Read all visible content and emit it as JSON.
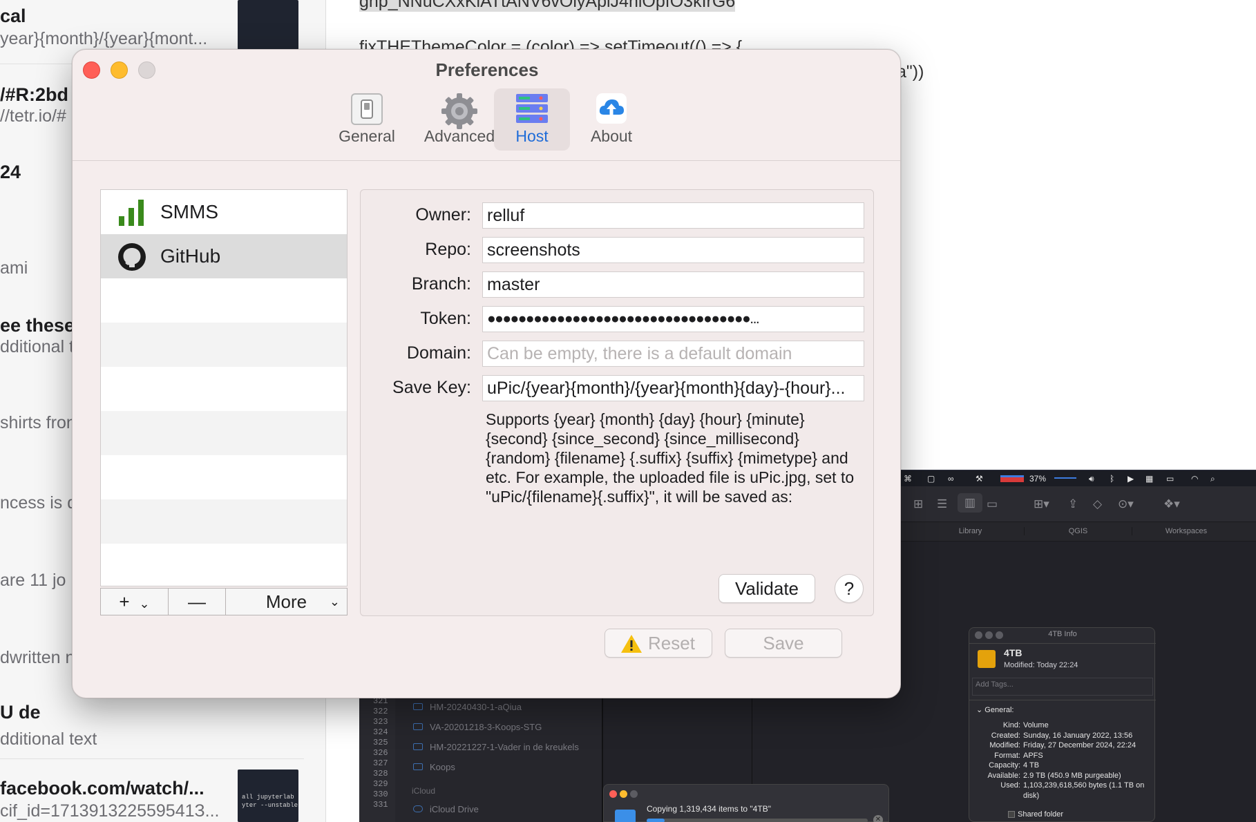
{
  "background_notes": [
    {
      "title": "cal",
      "subtitle": "year}{month}/{year}{mont..."
    },
    {
      "title": "/#R:2bd",
      "subtitle": "//tetr.io/#"
    },
    {
      "title": "24",
      "subtitle": ""
    },
    {
      "title": "",
      "subtitle": "ami"
    },
    {
      "title": "ee these",
      "subtitle": "dditional t"
    },
    {
      "title": "",
      "subtitle": "shirts fron"
    },
    {
      "title": "",
      "subtitle": "ncess is d"
    },
    {
      "title": "",
      "subtitle": "are 11 jo"
    },
    {
      "title": "",
      "subtitle": "dwritten n"
    },
    {
      "title": "U de",
      "subtitle": "dditional text"
    },
    {
      "title": "facebook.com/watch/...",
      "subtitle": "cif_id=171391322559541З..."
    }
  ],
  "thumb_code": "all jupyterlab\nyter --unstable",
  "editor": {
    "line1": "ghp_NNuCXxKlATtANV6vOlyApiJ4nlOpfO3kIrG6",
    "line2": "fixTHEThemeColor = (color) => setTimeout(() => {",
    "line3": "a\"))"
  },
  "menubar": {
    "battery_pct": "37%"
  },
  "finder": {
    "tabs": [
      "Library",
      "QGIS",
      "Workspaces"
    ],
    "line_numbers": [
      "321",
      "322",
      "323",
      "324",
      "325",
      "326",
      "327",
      "328",
      "329",
      "330",
      "331"
    ],
    "sidebar_items": [
      "HM-20240430-1-aQiua",
      "VA-20201218-3-Koops-STG",
      "HM-20221227-1-Vader in de kreukels",
      "Koops"
    ],
    "sidebar_header": "iCloud",
    "icloud_drive": "iCloud Drive"
  },
  "info_window": {
    "title": "4TB Info",
    "name": "4TB",
    "modified": "Modified: Today 22:24",
    "add_tags": "Add Tags...",
    "general": "General:",
    "rows": [
      {
        "k": "Kind:",
        "v": "Volume"
      },
      {
        "k": "Created:",
        "v": "Sunday, 16 January 2022, 13:56"
      },
      {
        "k": "Modified:",
        "v": "Friday, 27 December 2024, 22:24"
      },
      {
        "k": "Format:",
        "v": "APFS"
      },
      {
        "k": "Capacity:",
        "v": "4 TB"
      },
      {
        "k": "Available:",
        "v": "2.9 TB (450.9 MB purgeable)"
      },
      {
        "k": "Used:",
        "v": "1,103,239,618,560 bytes (1.1 TB on disk)"
      }
    ],
    "shared_folder": "Shared folder"
  },
  "copy_window": {
    "text": "Copying 1,319,434 items to \"4TB\""
  },
  "prefs": {
    "title": "Preferences",
    "tabs": [
      {
        "label": "General",
        "icon": "switch-icon"
      },
      {
        "label": "Advanced",
        "icon": "gear-icon"
      },
      {
        "label": "Host",
        "icon": "server-icon",
        "selected": true
      },
      {
        "label": "About",
        "icon": "cloud-upload-icon"
      }
    ],
    "hosts": [
      {
        "name": "SMMS",
        "icon": "bar-chart-icon"
      },
      {
        "name": "GitHub",
        "icon": "github-icon",
        "selected": true
      }
    ],
    "list_buttons": {
      "add": "+",
      "remove": "—",
      "more": "More"
    },
    "fields": {
      "owner": {
        "label": "Owner:",
        "value": "relluf"
      },
      "repo": {
        "label": "Repo:",
        "value": "screenshots"
      },
      "branch": {
        "label": "Branch:",
        "value": "master"
      },
      "token": {
        "label": "Token:",
        "value": "●●●●●●●●●●●●●●●●●●●●●●●●●●●●●●●●●●..."
      },
      "domain": {
        "label": "Domain:",
        "placeholder": "Can be empty, there is a default domain"
      },
      "save_key": {
        "label": "Save Key:",
        "value": "uPic/{year}{month}/{year}{month}{day}-{hour}..."
      }
    },
    "help": "Supports {year} {month} {day} {hour} {minute} {second} {since_second} {since_millisecond} {random} {filename} {.suffix} {suffix} {mimetype} and etc. For example, the uploaded file is uPic.jpg, set to \"uPic/{filename}{.suffix}\", it will be saved as:",
    "validate": "Validate",
    "help_button": "?",
    "reset": "Reset",
    "save": "Save"
  }
}
